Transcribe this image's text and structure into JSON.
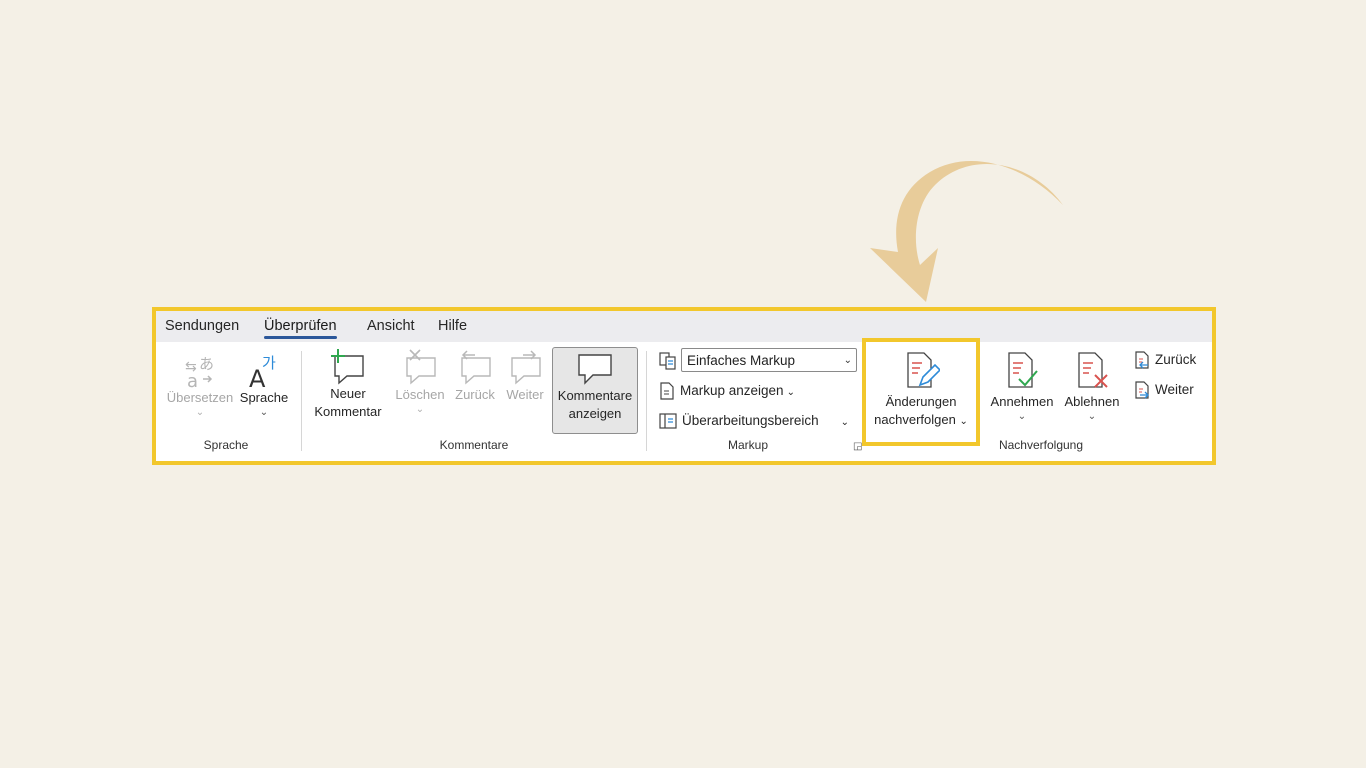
{
  "tabs": [
    {
      "label": "Sendungen",
      "active": false
    },
    {
      "label": "Überprüfen",
      "active": true
    },
    {
      "label": "Ansicht",
      "active": false
    },
    {
      "label": "Hilfe",
      "active": false
    }
  ],
  "groups": {
    "sprache": {
      "label": "Sprache",
      "translate": "Übersetzen",
      "language": "Sprache"
    },
    "kommentare": {
      "label": "Kommentare",
      "new_comment_line1": "Neuer",
      "new_comment_line2": "Kommentar",
      "delete": "Löschen",
      "back": "Zurück",
      "next": "Weiter",
      "show_comments_line1": "Kommentare",
      "show_comments_line2": "anzeigen"
    },
    "markup": {
      "label": "Markup",
      "dropdown_value": "Einfaches Markup",
      "show_markup": "Markup anzeigen",
      "revision_pane": "Überarbeitungsbereich"
    },
    "tracking": {
      "track_line1": "Änderungen",
      "track_line2": "nachverfolgen"
    },
    "nachverfolgung": {
      "label": "Nachverfolgung",
      "accept": "Annehmen",
      "reject": "Ablehnen",
      "previous": "Zurück",
      "next": "Weiter"
    }
  },
  "colors": {
    "background": "#f4f0e6",
    "highlight": "#f2c72c",
    "arrow": "#e8cc9a",
    "accent_tab": "#2b579a"
  }
}
